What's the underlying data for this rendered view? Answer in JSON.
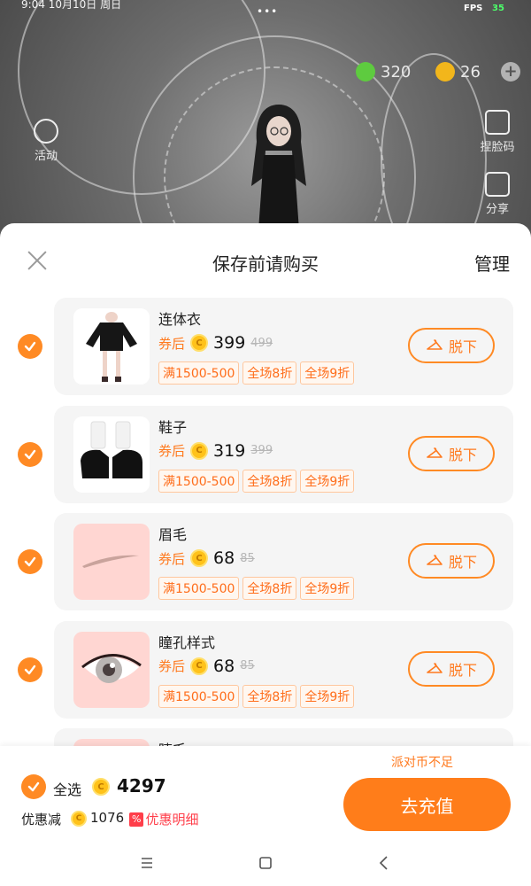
{
  "status": {
    "time": "9:04 10月10日 周日",
    "dots": "•••",
    "fps_label": "FPS",
    "fps_value": "35"
  },
  "game": {
    "currency_green": {
      "value": "320",
      "color": "#5ecb3f"
    },
    "currency_gold": {
      "value": "26",
      "color": "#f2b61b"
    },
    "plus": "+",
    "side_buttons": [
      {
        "label": "捏脸码",
        "icon": "edit-icon"
      },
      {
        "label": "分享",
        "icon": "share-icon"
      },
      {
        "label": "活动",
        "icon": "star-icon"
      }
    ]
  },
  "sheet": {
    "title": "保存前请购买",
    "manage": "管理",
    "items": [
      {
        "name": "连体衣",
        "after_label": "券后",
        "price": "399",
        "original": "499",
        "tags": [
          "满1500-500",
          "全场8折",
          "全场9折"
        ],
        "remove_label": "脱下",
        "thumb": "dress-thumbnail",
        "checked": true
      },
      {
        "name": "鞋子",
        "after_label": "券后",
        "price": "319",
        "original": "399",
        "tags": [
          "满1500-500",
          "全场8折",
          "全场9折"
        ],
        "remove_label": "脱下",
        "thumb": "shoes-thumbnail",
        "checked": true
      },
      {
        "name": "眉毛",
        "after_label": "券后",
        "price": "68",
        "original": "85",
        "tags": [
          "满1500-500",
          "全场8折",
          "全场9折"
        ],
        "remove_label": "脱下",
        "thumb": "eyebrow-thumbnail",
        "checked": true
      },
      {
        "name": "瞳孔样式",
        "after_label": "券后",
        "price": "68",
        "original": "85",
        "tags": [
          "满1500-500",
          "全场8折",
          "全场9折"
        ],
        "remove_label": "脱下",
        "thumb": "pupil-thumbnail",
        "checked": true
      },
      {
        "name": "睫毛",
        "after_label": "",
        "price": "",
        "original": "",
        "tags": [],
        "remove_label": "",
        "thumb": "eyelash-thumbnail",
        "checked": true
      }
    ]
  },
  "footer": {
    "select_all": "全选",
    "total": "4297",
    "discount_label": "优惠减",
    "discount_value": "1076",
    "detail_badge": "%",
    "detail_label": "优惠明细",
    "insufficient": "派对币不足",
    "recharge": "去充值",
    "accent_color": "#ff7d1a"
  },
  "navbar": {
    "items": [
      "menu-icon",
      "home-icon",
      "back-icon"
    ]
  }
}
